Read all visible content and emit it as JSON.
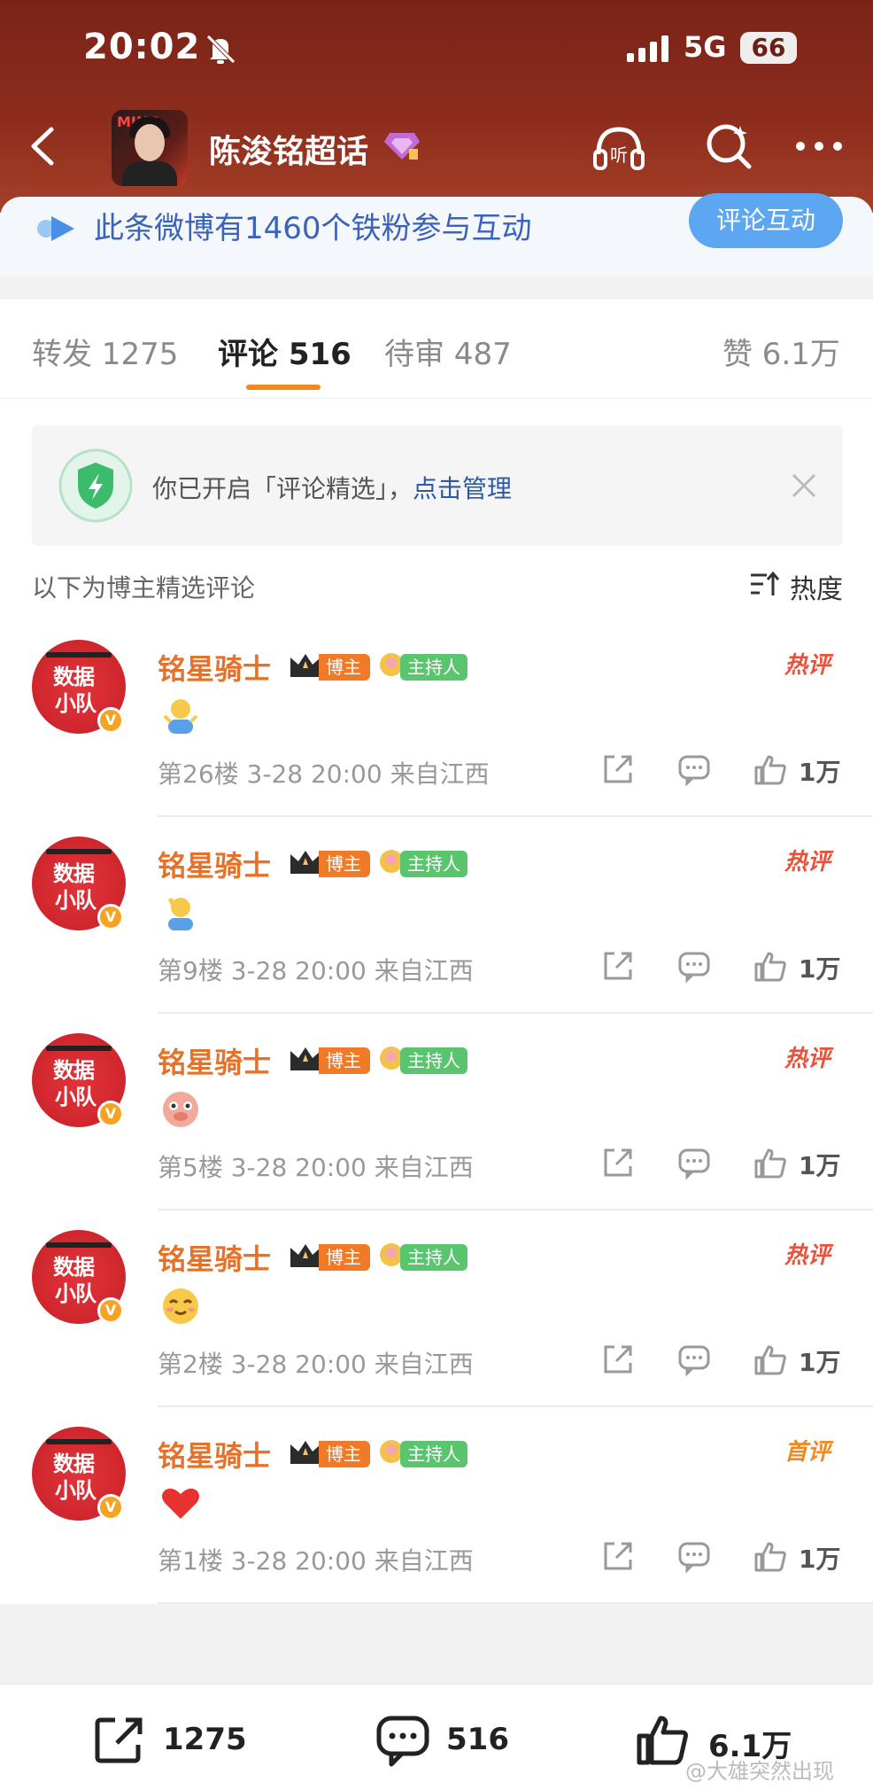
{
  "status": {
    "time": "20:02",
    "network": "5G",
    "battery": "66"
  },
  "header": {
    "title": "陈浚铭超话",
    "avatar_mark": "MING"
  },
  "banner": {
    "text": "此条微博有1460个铁粉参与互动",
    "button": "评论互动"
  },
  "tabs": [
    {
      "label": "转发 1275"
    },
    {
      "label": "评论 516"
    },
    {
      "label": "待审 487"
    },
    {
      "label": "赞 6.1万"
    }
  ],
  "notice": {
    "text": "你已开启「评论精选」，",
    "link": "点击管理"
  },
  "section": {
    "label": "以下为博主精选评论",
    "sort": "热度"
  },
  "comments": [
    {
      "avatar_line1": "数据",
      "avatar_line2": "小队",
      "name": "铭星骑士",
      "tag1": "博主",
      "tag2": "主持人",
      "badge": "热评",
      "emoji": "person-shrug",
      "meta": "第26楼  3-28 20:00  来自江西",
      "likes": "1万"
    },
    {
      "avatar_line1": "数据",
      "avatar_line2": "小队",
      "name": "铭星骑士",
      "tag1": "博主",
      "tag2": "主持人",
      "badge": "热评",
      "emoji": "person-salute",
      "meta": "第9楼  3-28 20:00  来自江西",
      "likes": "1万"
    },
    {
      "avatar_line1": "数据",
      "avatar_line2": "小队",
      "name": "铭星骑士",
      "tag1": "博主",
      "tag2": "主持人",
      "badge": "热评",
      "emoji": "pig-face",
      "meta": "第5楼  3-28 20:00  来自江西",
      "likes": "1万"
    },
    {
      "avatar_line1": "数据",
      "avatar_line2": "小队",
      "name": "铭星骑士",
      "tag1": "博主",
      "tag2": "主持人",
      "badge": "热评",
      "emoji": "smile-face",
      "meta": "第2楼  3-28 20:00  来自江西",
      "likes": "1万"
    },
    {
      "avatar_line1": "数据",
      "avatar_line2": "小队",
      "name": "铭星骑士",
      "tag1": "博主",
      "tag2": "主持人",
      "badge": "首评",
      "emoji": "red-heart",
      "meta": "第1楼  3-28 20:00  来自江西",
      "likes": "1万"
    }
  ],
  "bottom": {
    "repost": "1275",
    "comment": "516",
    "like": "6.1万"
  },
  "watermark": "@大雄突然出现",
  "colors": {
    "header_bg": "#8c2c1c",
    "accent_orange": "#f08a1e",
    "link_blue": "#2c5aa0",
    "banner_btn": "#5ca6f2",
    "host_green": "#5bc46f"
  }
}
